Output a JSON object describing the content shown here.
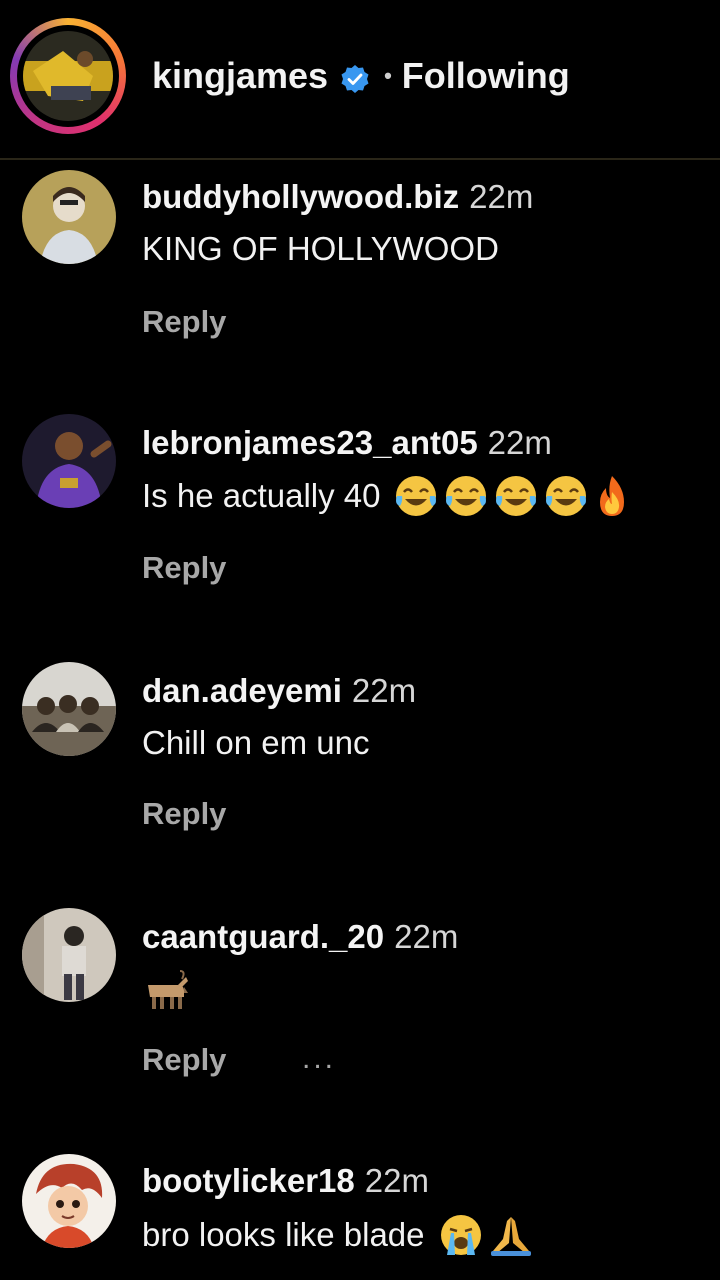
{
  "header": {
    "username": "kingjames",
    "separator": "•",
    "follow_status": "Following"
  },
  "comments": [
    {
      "username": "buddyhollywood.biz",
      "time": "22m",
      "text": "KING OF HOLLYWOOD",
      "reply_label": "Reply"
    },
    {
      "username": "lebronjames23_ant05",
      "time": "22m",
      "text": "Is he actually 40",
      "emojis": [
        "tears-of-joy-emoji",
        "tears-of-joy-emoji",
        "tears-of-joy-emoji",
        "tears-of-joy-emoji",
        "fire-emoji"
      ],
      "reply_label": "Reply"
    },
    {
      "username": "dan.adeyemi",
      "time": "22m",
      "text": "Chill on em unc",
      "reply_label": "Reply"
    },
    {
      "username": "caantguard._20",
      "time": "22m",
      "text": "",
      "emojis": [
        "goat-emoji"
      ],
      "reply_label": "Reply",
      "more_label": "..."
    },
    {
      "username": "bootylicker18",
      "time": "22m",
      "text": "bro looks like blade",
      "emojis": [
        "loudly-crying-emoji",
        "folded-hands-emoji"
      ]
    }
  ],
  "colors": {
    "background": "#000000",
    "text": "#f2f2f2",
    "secondary_text": "#a8a8a8",
    "verified_blue": "#3897f0",
    "story_ring": [
      "#f9b233",
      "#f77737",
      "#e1306c",
      "#c13584",
      "#833ab4"
    ]
  }
}
